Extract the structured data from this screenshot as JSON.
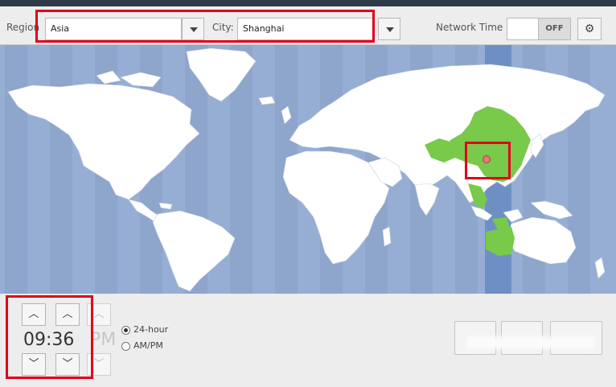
{
  "toolbar": {
    "region_label": "Region",
    "region_value": "Asia",
    "city_label": "City:",
    "city_value": "Shanghai",
    "network_time_label": "Network Time",
    "network_time_state": "OFF"
  },
  "map": {
    "selected_city": "Shanghai",
    "accent_color": "#79c94a",
    "timezone_band_color": "#6d8fc4",
    "ocean_color": "#97aed4"
  },
  "clock": {
    "time": "09:36",
    "suffix": "PM",
    "format_options": [
      "24-hour",
      "AM/PM"
    ],
    "selected_format": "24-hour"
  },
  "colors": {
    "highlight": "#e1001a"
  }
}
